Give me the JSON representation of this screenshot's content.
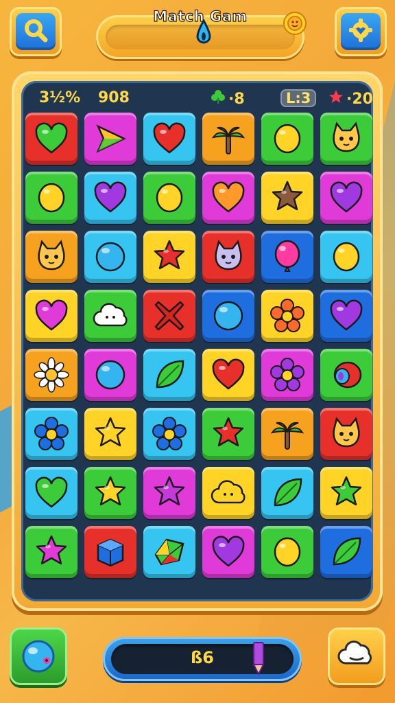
{
  "header": {
    "title": "Match Gam",
    "left_button_icon": "search-icon",
    "right_button_icon": "settings-gear-icon",
    "drop_icon": "water-drop-icon",
    "sun_icon": "sun-icon"
  },
  "stats": {
    "percent": "3½%",
    "score": "908",
    "clover_count": "·8",
    "level": "L:3",
    "star_count": "·20"
  },
  "board": {
    "columns": 6,
    "rows": 8,
    "tiles": [
      {
        "color": "#e8302a",
        "icon": "heart",
        "fill": "#3ccc3a"
      },
      {
        "color": "#e03ad8",
        "icon": "arrow",
        "fill": "#ffc22a"
      },
      {
        "color": "#35c5f0",
        "icon": "heart",
        "fill": "#e8302a"
      },
      {
        "color": "#f6a21f",
        "icon": "palm",
        "fill": "#3ab83a"
      },
      {
        "color": "#3ccc3a",
        "icon": "lemon",
        "fill": "#ffd426"
      },
      {
        "color": "#3ccc3a",
        "icon": "cat",
        "fill": "#ffc84a"
      },
      {
        "color": "#3ccc3a",
        "icon": "lemon",
        "fill": "#ffd426"
      },
      {
        "color": "#35c5f0",
        "icon": "heart",
        "fill": "#a03ae0"
      },
      {
        "color": "#3ccc3a",
        "icon": "lemon",
        "fill": "#ffd426"
      },
      {
        "color": "#e03ad8",
        "icon": "heart",
        "fill": "#ff9a2a"
      },
      {
        "color": "#ffd426",
        "icon": "star",
        "fill": "#8a5a3a"
      },
      {
        "color": "#e03ad8",
        "icon": "heart",
        "fill": "#a03ae0"
      },
      {
        "color": "#f6a21f",
        "icon": "cat",
        "fill": "#ffc84a"
      },
      {
        "color": "#35c5f0",
        "icon": "bubble",
        "fill": "#35b5f0"
      },
      {
        "color": "#ffd426",
        "icon": "star",
        "fill": "#e8302a"
      },
      {
        "color": "#e8302a",
        "icon": "cat",
        "fill": "#c7c0ee"
      },
      {
        "color": "#1e6ee0",
        "icon": "balloon",
        "fill": "#ff3aa0"
      },
      {
        "color": "#35c5f0",
        "icon": "lemon",
        "fill": "#ffd426"
      },
      {
        "color": "#ffd426",
        "icon": "heart",
        "fill": "#e03ad8"
      },
      {
        "color": "#3ccc3a",
        "icon": "cloud",
        "fill": "#ffffff"
      },
      {
        "color": "#e8302a",
        "icon": "cross",
        "fill": "#d8241e"
      },
      {
        "color": "#1e6ee0",
        "icon": "bubble",
        "fill": "#35b5f0"
      },
      {
        "color": "#ffd426",
        "icon": "flower",
        "fill": "#ff6a2a"
      },
      {
        "color": "#1e6ee0",
        "icon": "heart",
        "fill": "#a03ae0"
      },
      {
        "color": "#f6a21f",
        "icon": "daisy",
        "fill": "#ffffff"
      },
      {
        "color": "#e03ad8",
        "icon": "bubble",
        "fill": "#35b5f0"
      },
      {
        "color": "#35c5f0",
        "icon": "leaf",
        "fill": "#3ccc3a"
      },
      {
        "color": "#ffd426",
        "icon": "heart",
        "fill": "#e8302a"
      },
      {
        "color": "#e03ad8",
        "icon": "flower",
        "fill": "#a03ae0"
      },
      {
        "color": "#3ccc3a",
        "icon": "donut",
        "fill": "#e8302a"
      },
      {
        "color": "#35c5f0",
        "icon": "flower",
        "fill": "#1e6ee0"
      },
      {
        "color": "#ffd426",
        "icon": "star",
        "fill": "#ffd426"
      },
      {
        "color": "#35c5f0",
        "icon": "flower",
        "fill": "#1e6ee0"
      },
      {
        "color": "#3ccc3a",
        "icon": "star",
        "fill": "#e8302a"
      },
      {
        "color": "#f6a21f",
        "icon": "palm",
        "fill": "#3ab83a"
      },
      {
        "color": "#e8302a",
        "icon": "cat",
        "fill": "#ffc84a"
      },
      {
        "color": "#35c5f0",
        "icon": "heart",
        "fill": "#3ccc3a"
      },
      {
        "color": "#3ccc3a",
        "icon": "star",
        "fill": "#ffd426"
      },
      {
        "color": "#e03ad8",
        "icon": "star",
        "fill": "#c43ad8"
      },
      {
        "color": "#ffd426",
        "icon": "cloud",
        "fill": "#ffd426"
      },
      {
        "color": "#35c5f0",
        "icon": "leaf",
        "fill": "#3ccc3a"
      },
      {
        "color": "#ffd426",
        "icon": "star",
        "fill": "#3ccc3a"
      },
      {
        "color": "#3ccc3a",
        "icon": "star",
        "fill": "#e03ad8"
      },
      {
        "color": "#e8302a",
        "icon": "cube",
        "fill": "#1e6ee0"
      },
      {
        "color": "#35c5f0",
        "icon": "gem",
        "fill": "#3ccc3a"
      },
      {
        "color": "#e03ad8",
        "icon": "heart",
        "fill": "#a03ae0"
      },
      {
        "color": "#3ccc3a",
        "icon": "lemon",
        "fill": "#ffd426"
      },
      {
        "color": "#1e6ee0",
        "icon": "leaf",
        "fill": "#3ccc3a"
      }
    ]
  },
  "footer": {
    "left_button_icon": "booster-orb-icon",
    "progress_text": "ß6",
    "progress_icon": "pencil-icon",
    "right_button_icon": "cloud-icon"
  }
}
